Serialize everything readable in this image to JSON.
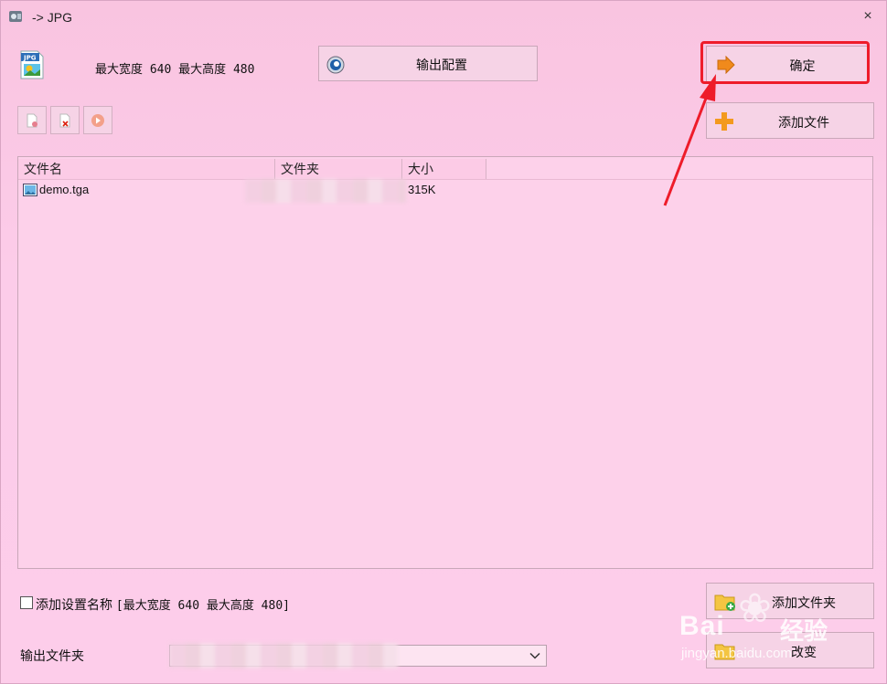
{
  "window": {
    "title": "-> JPG",
    "close_glyph": "×"
  },
  "settings": {
    "dimensions_text": "最大宽度 640 最大高度 480"
  },
  "buttons": {
    "output_config": "输出配置",
    "confirm": "确定",
    "add_file": "添加文件",
    "add_folder": "添加文件夹",
    "change": "改变"
  },
  "toolbar": {
    "icons": [
      "remove-file-icon",
      "delete-icon",
      "play-icon"
    ]
  },
  "file_list": {
    "columns": [
      "文件名",
      "文件夹",
      "大小"
    ],
    "rows": [
      {
        "name": "demo.tga",
        "folder": "",
        "size": "315K"
      }
    ]
  },
  "footer": {
    "checkbox_label": "添加设置名称",
    "checkbox_checked": false,
    "checkbox_suffix": "[最大宽度 640 最大高度 480]",
    "output_folder_label": "输出文件夹",
    "output_folder_value": ""
  },
  "annotation": {
    "color": "#ee1c2a",
    "target": "confirm-button"
  },
  "watermark": {
    "brand": "Bai",
    "brand2": "经验",
    "url": "jingyan.baidu.com"
  },
  "colors": {
    "background": "#fdc6e6",
    "button_bg": "#f6d3e6",
    "accent_red": "#ee1c2a"
  }
}
